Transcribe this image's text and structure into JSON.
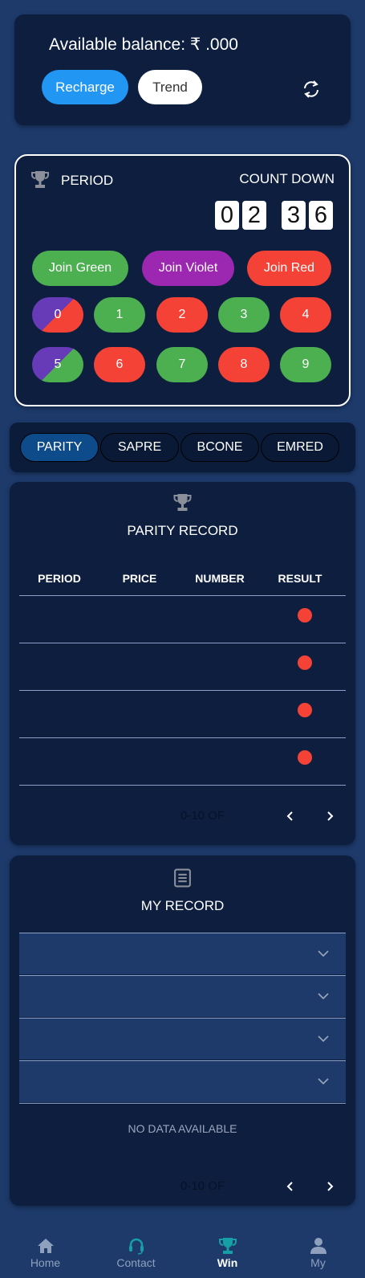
{
  "balance": {
    "label": "Available balance: ₹ .000",
    "recharge_label": "Recharge",
    "trend_label": "Trend"
  },
  "period": {
    "period_label": "PERIOD",
    "countdown_label": "COUNT DOWN",
    "digits": [
      "0",
      "2",
      "3",
      "6"
    ],
    "join": {
      "green": "Join Green",
      "violet": "Join Violet",
      "red": "Join Red"
    },
    "numbers": [
      "0",
      "1",
      "2",
      "3",
      "4",
      "5",
      "6",
      "7",
      "8",
      "9"
    ]
  },
  "colors": {
    "green": "#4caf50",
    "violet": "#9c27b0",
    "red": "#f44336",
    "blue": "#2196f3",
    "teal": "#16a0a6"
  },
  "tabs": [
    "PARITY",
    "SAPRE",
    "BCONE",
    "EMRED"
  ],
  "parity_record": {
    "title": "PARITY RECORD",
    "columns": [
      "PERIOD",
      "PRICE",
      "NUMBER",
      "RESULT"
    ],
    "pager_text": "0-10 OF"
  },
  "my_record": {
    "title": "MY RECORD",
    "no_data": "NO DATA AVAILABLE",
    "pager_text": "0-10 OF"
  },
  "nav": {
    "home": "Home",
    "contact": "Contact",
    "win": "Win",
    "my": "My"
  }
}
